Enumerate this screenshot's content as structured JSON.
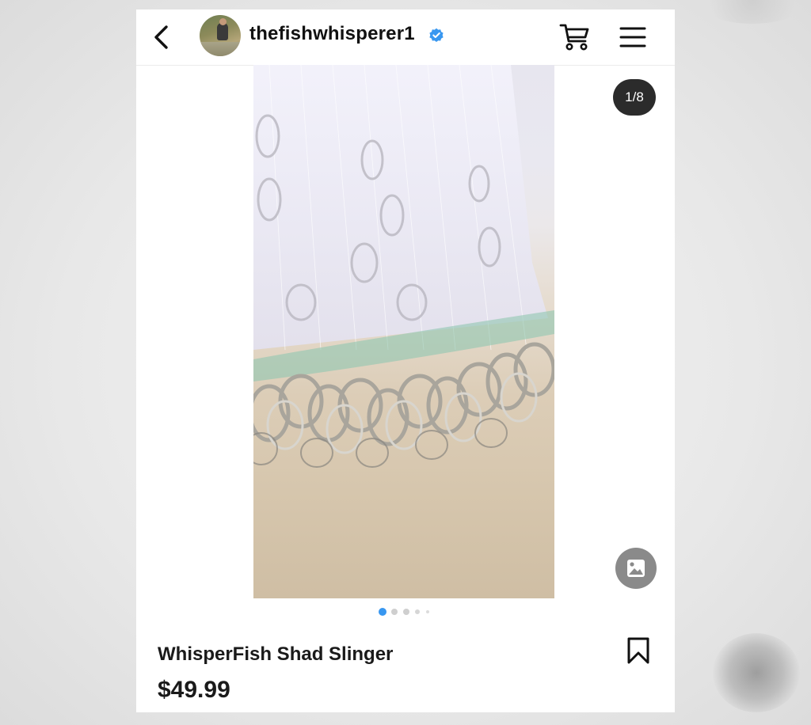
{
  "header": {
    "username": "thefishwhisperer1",
    "verified": true,
    "back_icon": "chevron-left-icon",
    "cart_icon": "shopping-cart-icon",
    "menu_icon": "hamburger-menu-icon"
  },
  "media": {
    "counter": "1/8",
    "gallery_icon": "image-icon",
    "carousel_dots_count": 5,
    "active_dot_index": 0
  },
  "product": {
    "title": "WhisperFish Shad Slinger",
    "price": "$49.99",
    "save_icon": "bookmark-icon"
  },
  "colors": {
    "accent": "#3897f0",
    "verified_badge": "#3897f0",
    "counter_bg": "#2b2b2b",
    "text": "#111111"
  }
}
